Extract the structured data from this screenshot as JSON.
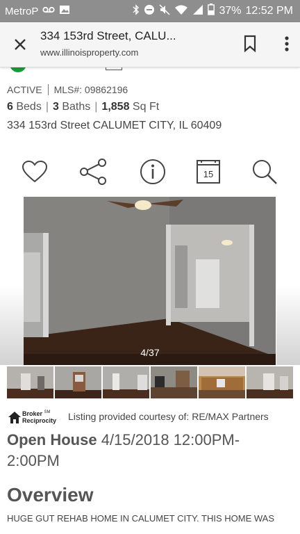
{
  "status_bar": {
    "carrier": "MetroP",
    "battery": "37%",
    "time": "12:52 PM",
    "icons": [
      "voicemail-icon",
      "image-icon",
      "bluetooth-icon",
      "do-not-disturb-icon",
      "mute-icon",
      "wifi-icon",
      "signal-icon",
      "battery-icon"
    ]
  },
  "browser": {
    "title": "334 153rd Street, CALU...",
    "url": "www.illinoisproperty.com",
    "icons": [
      "close-icon",
      "bookmark-icon",
      "overflow-menu-icon"
    ]
  },
  "listing": {
    "status": "ACTIVE",
    "mls": "MLS#: 09862196",
    "beds_num": "6",
    "beds_label": "Beds",
    "baths_num": "3",
    "baths_label": "Baths",
    "sqft_num": "1,858",
    "sqft_label": "Sq Ft",
    "address": "334 153rd Street CALUMET CITY, IL 60409"
  },
  "actions": {
    "calendar_day": "15",
    "icons": [
      "heart-icon",
      "share-icon",
      "info-icon",
      "calendar-icon",
      "search-icon"
    ]
  },
  "gallery": {
    "counter": "4/37",
    "thumbnail_count": 6
  },
  "courtesy": {
    "logo_line1": "Broker",
    "logo_line2": "Reciprocity",
    "logo_sm": "SM",
    "text": "Listing provided courtesy of: RE/MAX Partners"
  },
  "open_house": {
    "label": "Open House",
    "value": "4/15/2018 12:00PM-2:00PM"
  },
  "overview": {
    "heading": "Overview",
    "description": "HUGE GUT REHAB HOME IN CALUMET CITY. THIS HOME WAS"
  },
  "colors": {
    "status_bar": "#8e8e8e",
    "toolbar": "#f5f5f5",
    "active_dot": "#1a9a3a"
  }
}
